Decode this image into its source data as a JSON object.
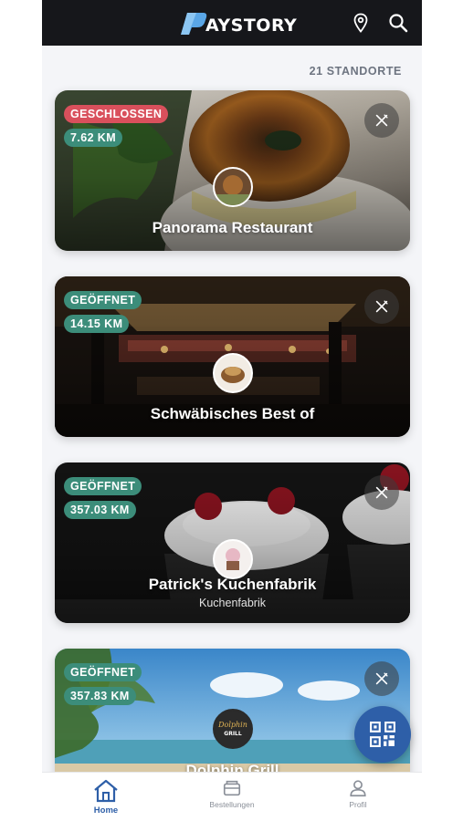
{
  "header": {
    "logo_text": "AYSTORY",
    "icons": [
      "location-pin-icon",
      "search-icon"
    ]
  },
  "locations_count": "21 STANDORTE",
  "cards": [
    {
      "status": "GESCHLOSSEN",
      "status_color": "#d9505c",
      "distance": "7.62 KM",
      "title": "Panorama Restaurant",
      "subtitle": ""
    },
    {
      "status": "GEÖFFNET",
      "status_color": "#3c8d7a",
      "distance": "14.15 KM",
      "title": "Schwäbisches Best of",
      "subtitle": ""
    },
    {
      "status": "GEÖFFNET",
      "status_color": "#3c8d7a",
      "distance": "357.03 KM",
      "title": "Patrick's Kuchenfabrik",
      "subtitle": "Kuchenfabrik"
    },
    {
      "status": "GEÖFFNET",
      "status_color": "#3c8d7a",
      "distance": "357.83 KM",
      "title": "Dolphin Grill",
      "subtitle": "",
      "logo_text": "Dolphin GRILL"
    }
  ],
  "fab": {
    "icon": "qr-code-icon"
  },
  "bottom_nav": {
    "items": [
      {
        "label": "Home",
        "icon": "home-icon",
        "active": true
      },
      {
        "label": "Bestellungen",
        "icon": "orders-icon",
        "active": false
      },
      {
        "label": "Profil",
        "icon": "profile-icon",
        "active": false
      }
    ]
  },
  "colors": {
    "accent": "#2e5fa8",
    "open": "#3c8d7a",
    "closed": "#d9505c",
    "topbar": "#16171b"
  }
}
